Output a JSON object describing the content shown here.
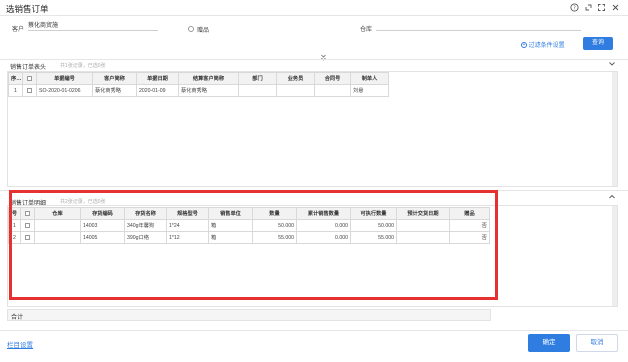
{
  "window": {
    "title": "选销售订单"
  },
  "titlebar_icons": [
    "help-icon",
    "restore-icon",
    "maximize-icon",
    "close-icon"
  ],
  "filter": {
    "customer_label": "客户",
    "customer_value": "蔡化商贸施",
    "gift_label": "赠品",
    "warehouse_label": "仓库",
    "warehouse_value": "",
    "filter_settings": "过滤条件设置",
    "query_button": "查询"
  },
  "header_section": {
    "title": "销售订单表头",
    "summary": "共1张记录，已选0张",
    "columns": [
      "序号",
      "",
      "单据编号",
      "客户简称",
      "单据日期",
      "结算客户简称",
      "部门",
      "业务员",
      "合同号",
      "制单人"
    ],
    "rows": [
      [
        "1",
        "",
        "SO-2020-01-0206",
        "蔡化商秀略",
        "2020-01-09",
        "蔡化商秀略",
        "",
        "",
        "",
        "刘悬"
      ]
    ]
  },
  "detail_section": {
    "title": "销售订单明细",
    "summary": "共2张记录，已选0张",
    "columns": [
      "号",
      "",
      "仓库",
      "存货编码",
      "存货名称",
      "规格型号",
      "销售单位",
      "数量",
      "累计销售数量",
      "可执行数量",
      "预计交货日期",
      "赠品"
    ],
    "rows": [
      [
        "1",
        "",
        "",
        "14003",
        "340g年馨狗",
        "1*24",
        "箱",
        "50.000",
        "0.000",
        "50.000",
        "",
        "否"
      ],
      [
        "2",
        "",
        "",
        "14005",
        "390g口络",
        "1*12",
        "箱",
        "55.000",
        "0.000",
        "55.000",
        "",
        "否"
      ]
    ],
    "total_label": "合计"
  },
  "footer": {
    "column_settings": "栏目设置",
    "confirm": "确定",
    "cancel": "取消"
  },
  "colors": {
    "accent": "#2f7de1",
    "highlight_box": "#e5312f"
  }
}
